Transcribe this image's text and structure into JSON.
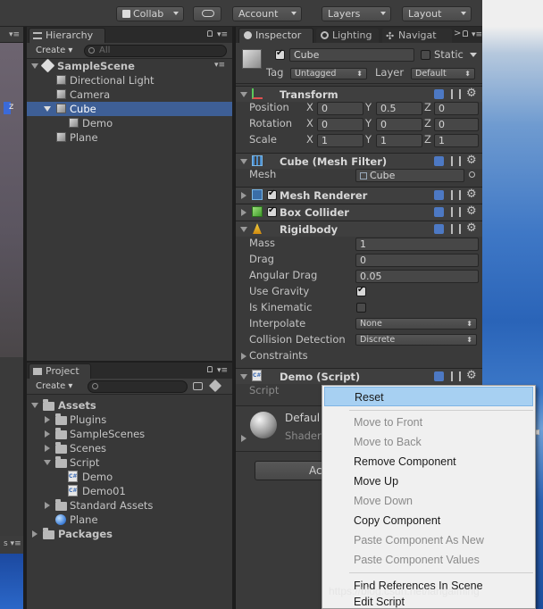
{
  "toolbar": {
    "collab": "Collab",
    "account": "Account",
    "layers": "Layers",
    "layout": "Layout"
  },
  "hierarchy": {
    "tab": "Hierarchy",
    "create": "Create",
    "search_placeholder": "All",
    "items": [
      {
        "label": "SampleScene"
      },
      {
        "label": "Directional Light"
      },
      {
        "label": "Camera"
      },
      {
        "label": "Cube"
      },
      {
        "label": "Demo"
      },
      {
        "label": "Plane"
      }
    ]
  },
  "project": {
    "tab": "Project",
    "create": "Create",
    "items": [
      {
        "label": "Assets"
      },
      {
        "label": "Plugins"
      },
      {
        "label": "SampleScenes"
      },
      {
        "label": "Scenes"
      },
      {
        "label": "Script"
      },
      {
        "label": "Demo"
      },
      {
        "label": "Demo01"
      },
      {
        "label": "Standard Assets"
      },
      {
        "label": "Plane"
      },
      {
        "label": "Packages"
      }
    ]
  },
  "inspector": {
    "tabs": {
      "inspector": "Inspector",
      "lighting": "Lighting",
      "navigation": "Navigat"
    },
    "object_name": "Cube",
    "static_label": "Static",
    "tag_label": "Tag",
    "tag_value": "Untagged",
    "layer_label": "Layer",
    "layer_value": "Default",
    "transform": {
      "title": "Transform",
      "position_label": "Position",
      "position": {
        "x": "0",
        "y": "0.5",
        "z": "0"
      },
      "rotation_label": "Rotation",
      "rotation": {
        "x": "0",
        "y": "0",
        "z": "0"
      },
      "scale_label": "Scale",
      "scale": {
        "x": "1",
        "y": "1",
        "z": "1"
      },
      "x": "X",
      "y": "Y",
      "z": "Z"
    },
    "mesh_filter": {
      "title": "Cube (Mesh Filter)",
      "mesh_label": "Mesh",
      "mesh_value": "Cube"
    },
    "mesh_renderer": {
      "title": "Mesh Renderer"
    },
    "box_collider": {
      "title": "Box Collider"
    },
    "rigidbody": {
      "title": "Rigidbody",
      "mass_label": "Mass",
      "mass": "1",
      "drag_label": "Drag",
      "drag": "0",
      "angular_drag_label": "Angular Drag",
      "angular_drag": "0.05",
      "use_gravity_label": "Use Gravity",
      "is_kinematic_label": "Is Kinematic",
      "interpolate_label": "Interpolate",
      "interpolate": "None",
      "collision_label": "Collision Detection",
      "collision": "Discrete",
      "constraints_label": "Constraints"
    },
    "demo_script": {
      "title": "Demo (Script)",
      "script_label": "Script"
    },
    "material": {
      "name": "Defaul",
      "shader": "Shader"
    },
    "add_component": "Ac"
  },
  "context_menu": {
    "items": [
      {
        "label": "Reset"
      },
      {
        "label": "Move to Front"
      },
      {
        "label": "Move to Back"
      },
      {
        "label": "Remove Component"
      },
      {
        "label": "Move Up"
      },
      {
        "label": "Move Down"
      },
      {
        "label": "Copy Component"
      },
      {
        "label": "Paste Component As New"
      },
      {
        "label": "Paste Component Values"
      },
      {
        "label": "Find References In Scene"
      },
      {
        "label": "Edit Script"
      }
    ]
  },
  "watermark": "https://blog.csdn.net/iangaiming",
  "colors": {
    "selection": "#3e5f96",
    "menu_highlight": "#a7d0f2",
    "panel_bg": "#383838"
  }
}
